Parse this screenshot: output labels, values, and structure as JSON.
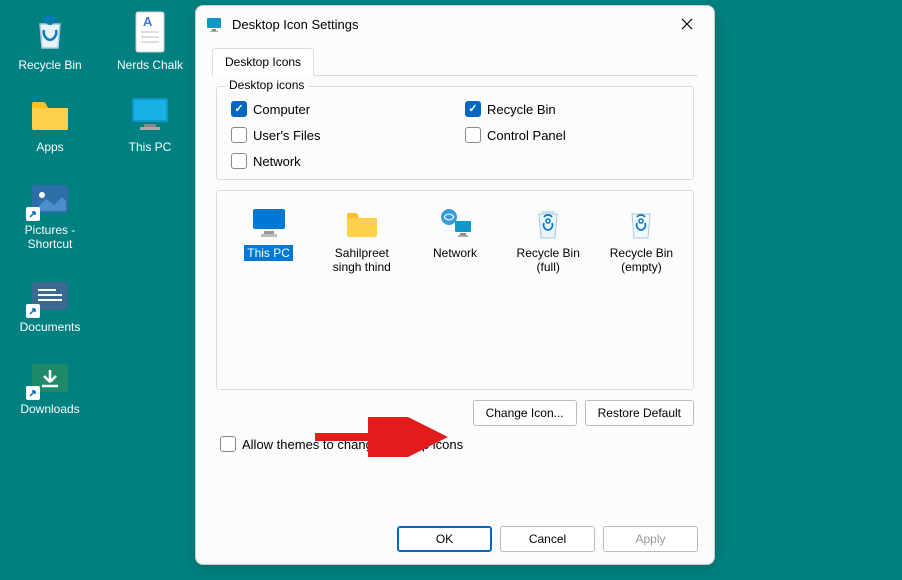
{
  "desktop": {
    "icons": [
      {
        "label": "Recycle Bin"
      },
      {
        "label": "Nerds Chalk"
      },
      {
        "label": "Apps"
      },
      {
        "label": "This PC"
      },
      {
        "label": "Pictures - Shortcut"
      },
      {
        "label": "Documents"
      },
      {
        "label": "Downloads"
      }
    ]
  },
  "dialog": {
    "title": "Desktop Icon Settings",
    "tab": "Desktop Icons",
    "group_legend": "Desktop icons",
    "checks": {
      "computer": "Computer",
      "users_files": "User's Files",
      "network": "Network",
      "recycle_bin": "Recycle Bin",
      "control_panel": "Control Panel"
    },
    "preview": [
      {
        "label": "This PC"
      },
      {
        "label": "Sahilpreet singh thind"
      },
      {
        "label": "Network"
      },
      {
        "label": "Recycle Bin (full)"
      },
      {
        "label": "Recycle Bin (empty)"
      }
    ],
    "change_icon": "Change Icon...",
    "restore_default": "Restore Default",
    "allow_themes": "Allow themes to change desktop icons",
    "ok": "OK",
    "cancel": "Cancel",
    "apply": "Apply"
  }
}
